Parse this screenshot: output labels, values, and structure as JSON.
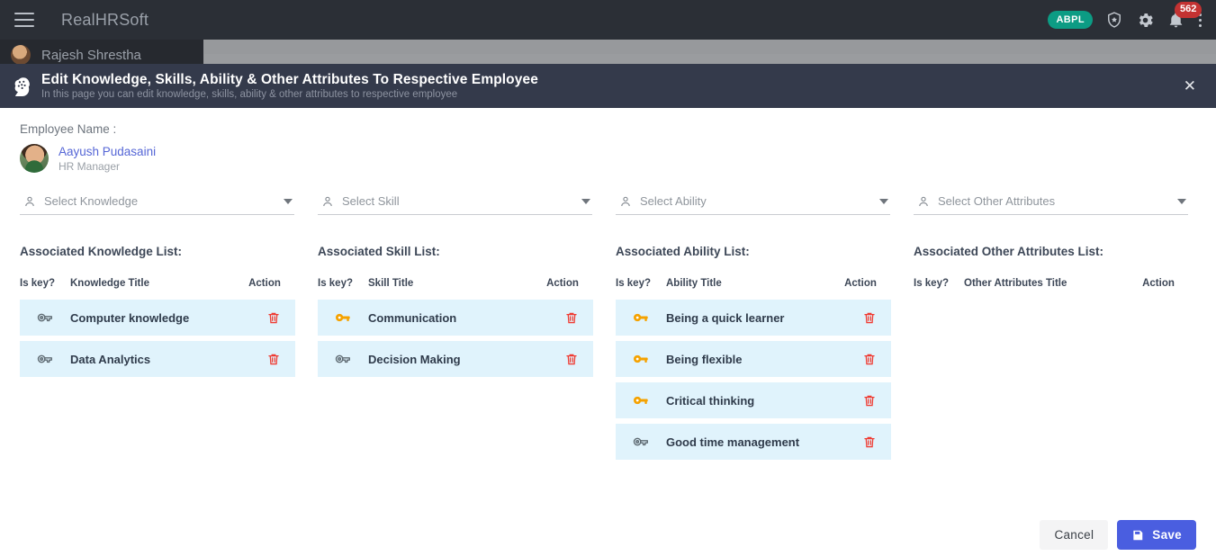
{
  "navbar": {
    "menu_icon": "hamburger-icon",
    "brand": "RealHRSoft",
    "org_badge": "ABPL",
    "shield_icon": "shield-star-icon",
    "settings_icon": "gear-icon",
    "bell_icon": "bell-icon",
    "notification_count": "562",
    "more_icon": "kebab-menu-icon",
    "badge_color": "#0c9c84",
    "notif_color": "#c33232"
  },
  "background": {
    "sidebar_user": "Rajesh Shrestha"
  },
  "modal": {
    "icon": "brain-icon",
    "title": "Edit Knowledge, Skills, Ability & Other Attributes To Respective Employee",
    "subtitle": "In this page you can edit knowledge, skills, ability & other attributes to respective employee",
    "close_label": "✕",
    "header_color": "#343a4b"
  },
  "employee": {
    "label": "Employee Name :",
    "name": "Aayush Pudasaini",
    "role": "HR Manager",
    "name_color": "#5566d6"
  },
  "columns": [
    {
      "select_placeholder": "Select Knowledge",
      "select_icon": "person-icon",
      "caret_icon": "chevron-down-icon",
      "list_title": "Associated Knowledge List:",
      "headers": {
        "is_key": "Is key?",
        "title": "Knowledge Title",
        "action": "Action"
      },
      "rows": [
        {
          "is_key": false,
          "title": "Computer knowledge",
          "action_icon": "trash-icon"
        },
        {
          "is_key": false,
          "title": "Data Analytics",
          "action_icon": "trash-icon"
        }
      ]
    },
    {
      "select_placeholder": "Select Skill",
      "select_icon": "person-icon",
      "caret_icon": "chevron-down-icon",
      "list_title": "Associated Skill List:",
      "headers": {
        "is_key": "Is key?",
        "title": "Skill Title",
        "action": "Action"
      },
      "rows": [
        {
          "is_key": true,
          "title": "Communication",
          "action_icon": "trash-icon"
        },
        {
          "is_key": false,
          "title": "Decision Making",
          "action_icon": "trash-icon"
        }
      ]
    },
    {
      "select_placeholder": "Select Ability",
      "select_icon": "person-icon",
      "caret_icon": "chevron-down-icon",
      "list_title": "Associated Ability List:",
      "headers": {
        "is_key": "Is key?",
        "title": "Ability Title",
        "action": "Action"
      },
      "rows": [
        {
          "is_key": true,
          "title": "Being a quick learner",
          "action_icon": "trash-icon"
        },
        {
          "is_key": true,
          "title": "Being flexible",
          "action_icon": "trash-icon"
        },
        {
          "is_key": true,
          "title": "Critical thinking",
          "action_icon": "trash-icon"
        },
        {
          "is_key": false,
          "title": "Good time management",
          "action_icon": "trash-icon"
        }
      ]
    },
    {
      "select_placeholder": "Select Other Attributes",
      "select_icon": "person-icon",
      "caret_icon": "chevron-down-icon",
      "list_title": "Associated Other Attributes List:",
      "headers": {
        "is_key": "Is key?",
        "title": "Other Attributes Title",
        "action": "Action"
      },
      "rows": []
    }
  ],
  "footer": {
    "cancel_label": "Cancel",
    "save_label": "Save",
    "save_icon": "save-disk-icon",
    "save_color": "#4a5ee0"
  },
  "palette": {
    "row_bg": "#e0f3fc",
    "key_active": "#f5a200",
    "key_inactive": "#5f6b73",
    "trash": "#ef3b32"
  }
}
